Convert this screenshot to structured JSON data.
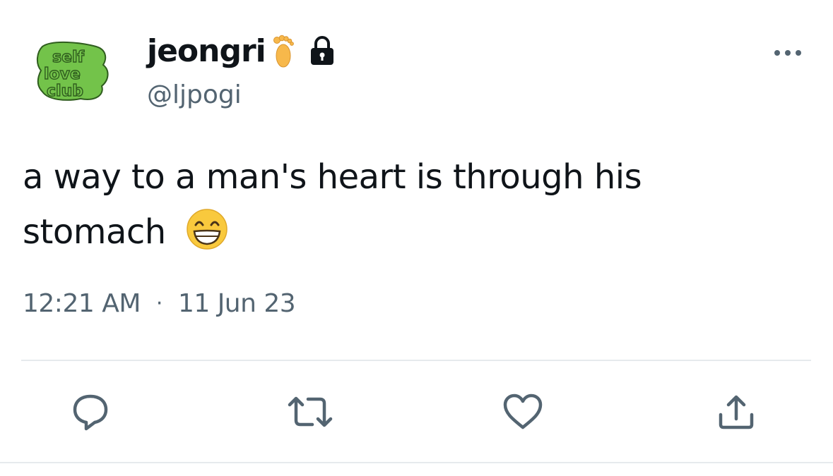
{
  "tweet": {
    "avatar": {
      "lines": [
        "self",
        "love",
        "club"
      ],
      "colors": {
        "fill": "#73c34a",
        "outline": "#2f5d1e"
      }
    },
    "author": {
      "display_name": "jeongri",
      "handle": "@ljpogi",
      "badge_icons": [
        "foot-emoji-icon",
        "lock-icon"
      ]
    },
    "more_icon": "more-options-icon",
    "text_line1": "a way to a man's heart is through his",
    "text_line2": "stomach",
    "text_emoji": "grinning-face-emoji",
    "meta": {
      "time": "12:21 AM",
      "separator": "·",
      "date": "11 Jun 23"
    },
    "actions": [
      "reply-icon",
      "retweet-icon",
      "like-icon",
      "share-icon"
    ]
  },
  "colors": {
    "text_primary": "#0f1419",
    "text_secondary": "#536471",
    "divider": "#e6eaed",
    "icon": "#536471"
  }
}
